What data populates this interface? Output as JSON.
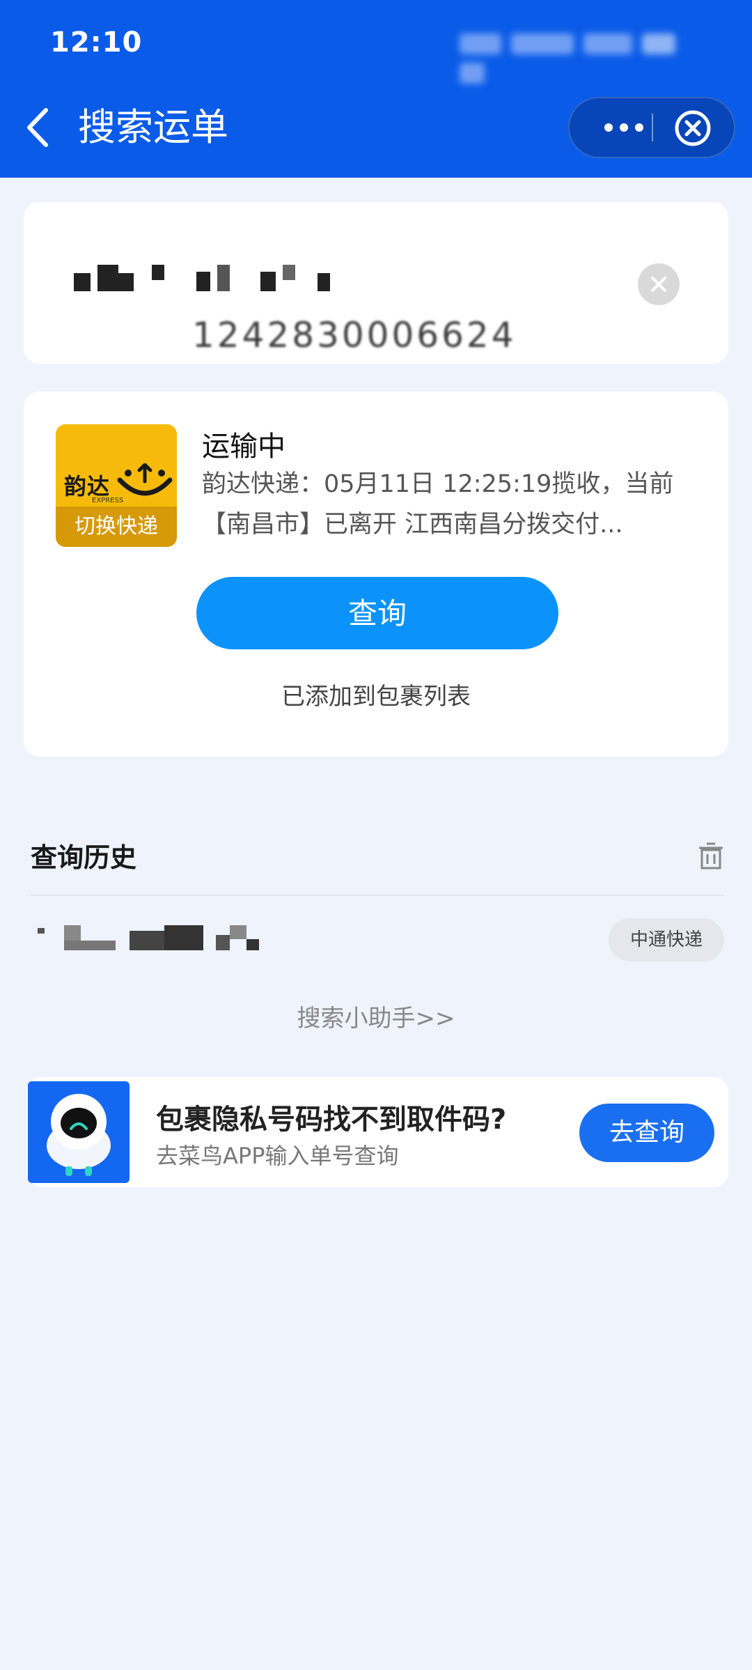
{
  "status_bar": {
    "time": "12:10"
  },
  "header": {
    "title": "搜索运单"
  },
  "search": {
    "tracking_number": "1242830006624"
  },
  "result": {
    "courier_logo_name": "韵达",
    "courier_logo_sub": "EXPRESS",
    "switch_courier_label": "切换快递",
    "status": "运输中",
    "description": "韵达快递：05月11日 12:25:19揽收，当前【南昌市】已离开 江西南昌分拨交付...",
    "query_button": "查询",
    "added_notice": "已添加到包裹列表"
  },
  "history": {
    "title": "查询历史",
    "items": [
      {
        "courier": "中通快递"
      }
    ]
  },
  "helper_link": "搜索小助手>>",
  "promo": {
    "title": "包裹隐私号码找不到取件码?",
    "subtitle": "去菜鸟APP输入单号查询",
    "button": "去查询"
  },
  "colors": {
    "header_blue": "#0a5be8",
    "query_button": "#0b93fb",
    "yunda_yellow": "#f6bb0a",
    "promo_button": "#1a6ff0",
    "page_background": "#eef3fc"
  },
  "icons": [
    "back-arrow-icon",
    "more-icon",
    "close-circle-icon",
    "clear-icon",
    "trash-icon",
    "cainiao-robot-icon"
  ]
}
